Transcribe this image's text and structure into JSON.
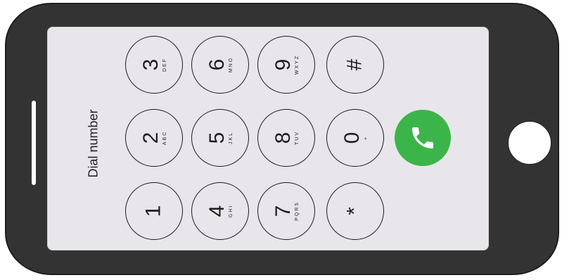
{
  "screen": {
    "label": "Dial number"
  },
  "keys": [
    {
      "id": "3",
      "digit": "3",
      "letters": "DEF"
    },
    {
      "id": "6",
      "digit": "6",
      "letters": "MNO"
    },
    {
      "id": "9",
      "digit": "9",
      "letters": "WXYZ"
    },
    {
      "id": "hash",
      "digit": "#",
      "letters": ""
    },
    {
      "id": "2",
      "digit": "2",
      "letters": "ABC"
    },
    {
      "id": "5",
      "digit": "5",
      "letters": "JKL"
    },
    {
      "id": "8",
      "digit": "8",
      "letters": "TUV"
    },
    {
      "id": "0",
      "digit": "0",
      "letters": "+"
    },
    {
      "id": "1",
      "digit": "1",
      "letters": ""
    },
    {
      "id": "4",
      "digit": "4",
      "letters": "GHI"
    },
    {
      "id": "7",
      "digit": "7",
      "letters": "PQRS"
    },
    {
      "id": "star",
      "digit": "*",
      "letters": ""
    }
  ],
  "call_button": {
    "icon": "phone-icon",
    "color": "#3bb54a"
  },
  "colors": {
    "phone_body": "#333333",
    "screen": "#e8e6eb",
    "outline": "#1e1e1e"
  }
}
